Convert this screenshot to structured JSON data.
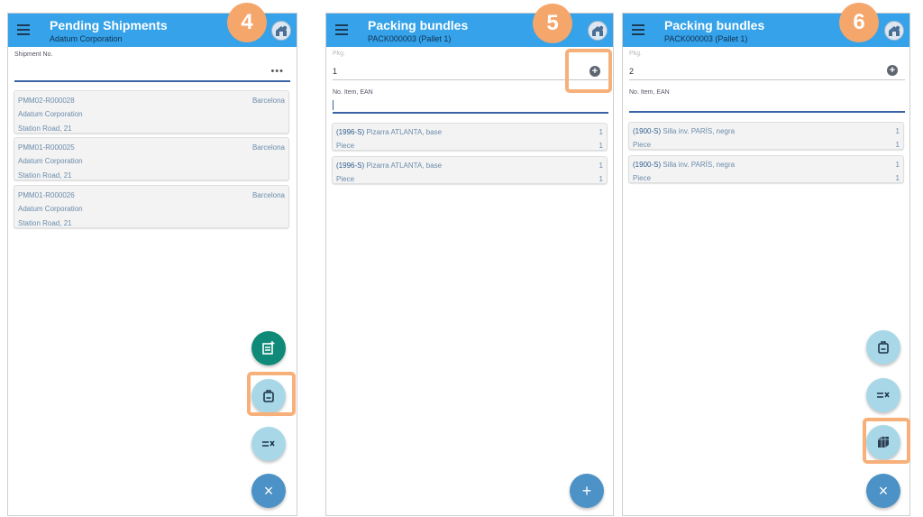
{
  "screens": [
    {
      "title": "Pending Shipments",
      "subtitle": "Adatum Corporation",
      "step": "4",
      "field": {
        "label": "Shipment No.",
        "value": ""
      },
      "cards": [
        {
          "code": "PMM02-R000028",
          "city": "Barcelona",
          "customer": "Adatum Corporation",
          "address": "Station Road, 21"
        },
        {
          "code": "PMM01-R000025",
          "city": "Barcelona",
          "customer": "Adatum Corporation",
          "address": "Station Road, 21"
        },
        {
          "code": "PMM01-R000026",
          "city": "Barcelona",
          "customer": "Adatum Corporation",
          "address": "Station Road, 21"
        }
      ]
    },
    {
      "title": "Packing bundles",
      "subtitle": "PACK000003 (Pallet 1)",
      "step": "5",
      "pkg": {
        "label": "Pkg.",
        "value": "1"
      },
      "item_field": {
        "label": "No. Item, EAN",
        "value": ""
      },
      "cards": [
        {
          "code": "(1996-S)",
          "name": "Pizarra ATLANTA, base",
          "qty": "1",
          "unit": "Piece",
          "unit_qty": "1"
        },
        {
          "code": "(1996-S)",
          "name": "Pizarra ATLANTA, base",
          "qty": "1",
          "unit": "Piece",
          "unit_qty": "1"
        }
      ],
      "add_label": "+"
    },
    {
      "title": "Packing bundles",
      "subtitle": "PACK000003 (Pallet 1)",
      "step": "6",
      "pkg": {
        "label": "Pkg.",
        "value": "2"
      },
      "item_field": {
        "label": "No. Item, EAN",
        "value": ""
      },
      "cards": [
        {
          "code": "(1900-S)",
          "name": "Silla inv. PARÍS, negra",
          "qty": "1",
          "unit": "Piece",
          "unit_qty": "1"
        },
        {
          "code": "(1900-S)",
          "name": "Silla inv. PARÍS, negra",
          "qty": "1",
          "unit": "Piece",
          "unit_qty": "1"
        }
      ]
    }
  ],
  "icons": {
    "menu": "hamburger-menu-icon",
    "home": "warehouse-home-icon",
    "more": "more-horizontal-icon",
    "add_pkg": "plus-circle-icon",
    "new_doc": "new-document-icon",
    "package": "package-icon",
    "checklist": "checklist-icon",
    "pallet": "pallet-icon",
    "close": "close-icon"
  },
  "dots_label": "•••",
  "close_label": "×",
  "colors": {
    "appbar": "#35a2e9",
    "step_badge": "#f5a66b",
    "highlight": "#f7b07a",
    "fab_light": "#a8d8e8",
    "fab_teal": "#0f8a78",
    "fab_blue": "#4c92c6"
  }
}
